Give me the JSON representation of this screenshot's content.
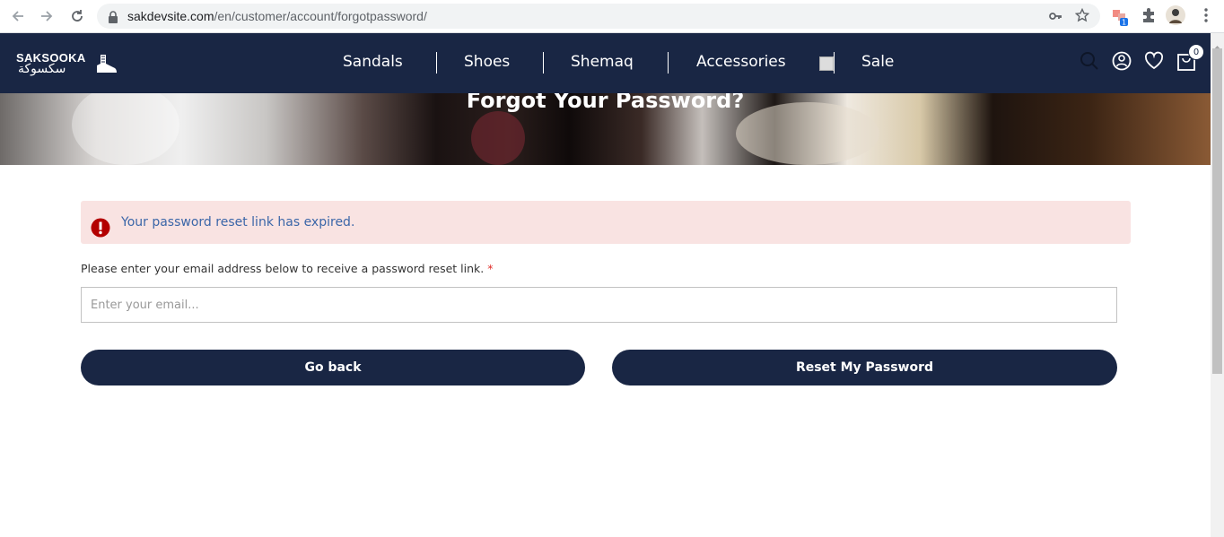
{
  "browser": {
    "url_host": "sakdevsite.com",
    "url_path": "/en/customer/account/forgotpassword/",
    "extension_badge": "1"
  },
  "header": {
    "logo_en": "SAKSOOKA",
    "logo_ar": "سكسوكة",
    "menu": [
      "Sandals",
      "Shoes",
      "Shemaq",
      "Accessories",
      "Sale"
    ],
    "cart_count": "0",
    "bg_color": "#192644"
  },
  "hero": {
    "title": "Forgot Your Password?"
  },
  "alert": {
    "message": "Your password reset link has expired."
  },
  "form": {
    "label": "Please enter your email address below to receive a password reset link.",
    "required_mark": "*",
    "email_placeholder": "Enter your email...",
    "email_value": ""
  },
  "buttons": {
    "back": "Go back",
    "reset": "Reset My Password"
  }
}
